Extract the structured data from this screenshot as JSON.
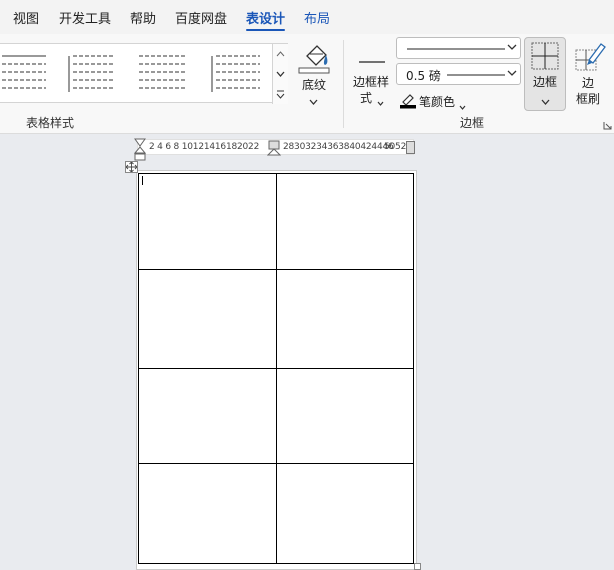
{
  "tabs": [
    {
      "label": "视图"
    },
    {
      "label": "开发工具"
    },
    {
      "label": "帮助"
    },
    {
      "label": "百度网盘"
    },
    {
      "label": "表设计"
    },
    {
      "label": "布局"
    }
  ],
  "active_tab": "表设计",
  "ribbon": {
    "table_styles": {
      "group_label": "表格样式"
    },
    "shading": {
      "label": "底纹"
    },
    "borders": {
      "group_label": "边框",
      "border_styles_label_line1": "边框样",
      "border_styles_label_line2": "式",
      "line_weight_value": "0.5 磅",
      "pen_color_label": "笔颜色",
      "borders_button_label": "边框",
      "border_painter_line1": "边",
      "border_painter_line2": "框刷"
    }
  },
  "ruler": {
    "left_numbers": "2  4  6  8 10121416182022",
    "right_numbers": "28303234363840424446",
    "end_numbers": "5052"
  },
  "colors": {
    "accent": "#1a56b8",
    "pen_color": "#000000",
    "shading_bucket": "#2b6cb0"
  },
  "icons": [
    "scroll-up-icon",
    "scroll-down-icon",
    "gallery-expand-icon",
    "paint-bucket-icon",
    "pen-icon",
    "borders-grid-icon",
    "border-painter-icon",
    "dialog-launcher-icon",
    "table-move-icon"
  ]
}
